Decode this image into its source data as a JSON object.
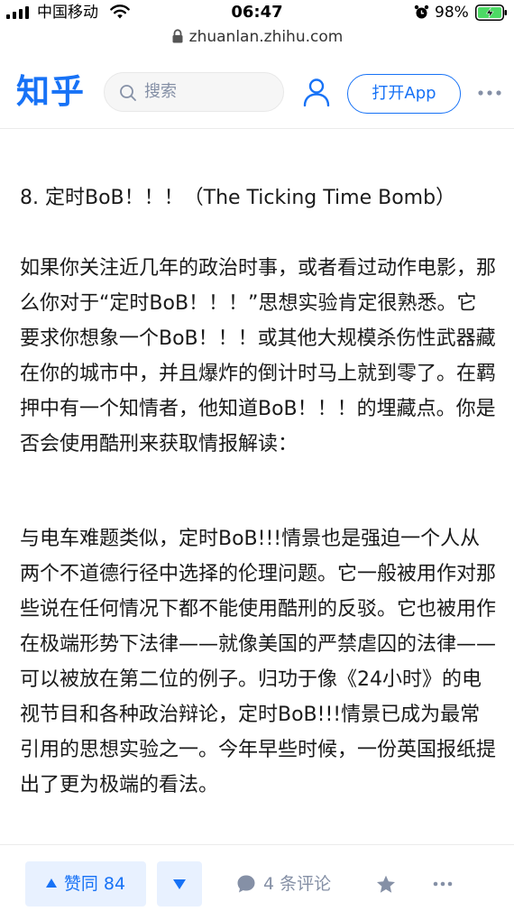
{
  "status_bar": {
    "carrier": "中国移动",
    "time": "06:47",
    "battery": "98%"
  },
  "browser": {
    "url": "zhuanlan.zhihu.com"
  },
  "header": {
    "logo": "知乎",
    "search_placeholder": "搜索",
    "open_app_label": "打开App"
  },
  "article": {
    "heading": "8. 定时BoB！！！（The Ticking Time Bomb）",
    "paragraphs": [
      "如果你关注近几年的政治时事，或者看过动作电影，那么你对于“定时BoB！！！”思想实验肯定很熟悉。它要求你想象一个BoB！！！或其他大规模杀伤性武器藏在你的城市中，并且爆炸的倒计时马上就到零了。在羁押中有一个知情者，他知道BoB！！！的埋藏点。你是否会使用酷刑来获取情报解读：",
      "与电车难题类似，定时BoB!!!情景也是强迫一个人从两个不道德行径中选择的伦理问题。它一般被用作对那些说在任何情况下都不能使用酷刑的反驳。它也被用作在极端形势下法律——就像美国的严禁虐囚的法律——可以被放在第二位的例子。归功于像《24小时》的电视节目和各种政治辩论，定时BoB!!!情景已成为最常引用的思想实验之一。今年早些时候，一份英国报纸提出了更为极端的看法。"
    ]
  },
  "actions": {
    "vote_up_label": "赞同 84",
    "comments_label": "4 条评论"
  },
  "colors": {
    "brand": "#1772f6",
    "vote_bg": "#e8f1ff",
    "muted": "#8590a6",
    "battery_green": "#4cd964"
  },
  "icons": {
    "signal": "signal-bars-icon",
    "wifi": "wifi-icon",
    "alarm": "alarm-icon",
    "battery": "battery-charging-icon",
    "lock": "lock-icon",
    "search": "search-icon",
    "user": "user-icon",
    "more": "more-icon",
    "comment": "comment-bubble-icon",
    "star": "star-icon"
  }
}
